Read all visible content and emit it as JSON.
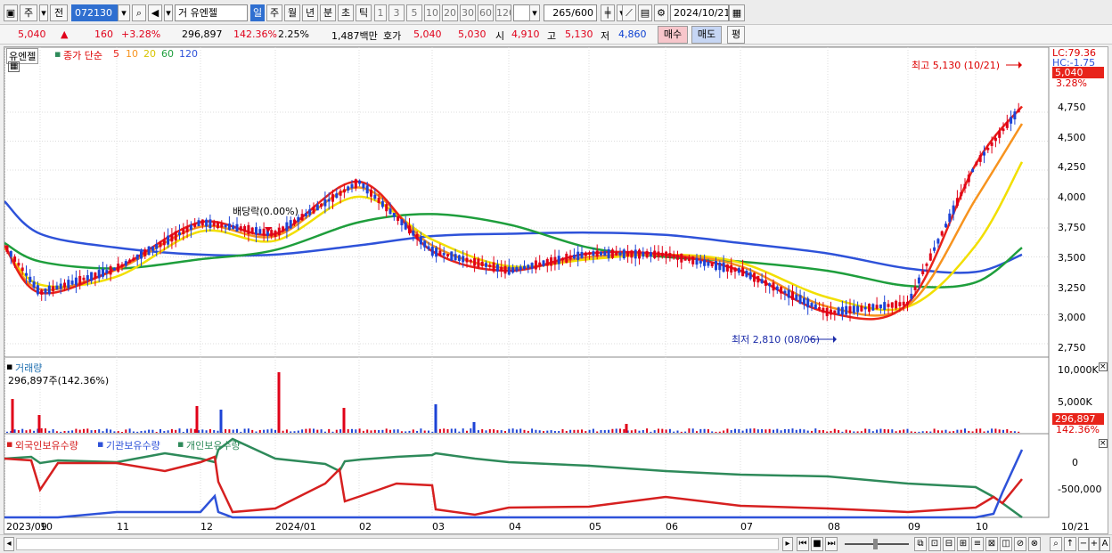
{
  "toolbar": {
    "market_type": "주",
    "prev_label": "전",
    "code": "072130",
    "name_prefix": "거",
    "name": "유엔젤",
    "period_tabs": [
      "일",
      "주",
      "월",
      "년",
      "분",
      "초",
      "틱"
    ],
    "selected_period": "일",
    "intervals": [
      "1",
      "3",
      "5",
      "10",
      "20",
      "30",
      "60",
      "120"
    ],
    "count": "265",
    "count_max": "/600",
    "date": "2024/10/21"
  },
  "price_row": {
    "price": "5,040",
    "change": "160",
    "change_pct": "+3.28%",
    "volume": "296,897",
    "volume_ratio": "142.36%",
    "turnover": "2.25%",
    "amount": "1,487백만",
    "quote_label": "호가",
    "ask": "5,040",
    "bid": "5,030",
    "open_label": "시",
    "open": "4,910",
    "high_label": "고",
    "high": "5,130",
    "low_label": "저",
    "low": "4,860",
    "buy_button": "매수",
    "sell_button": "매도",
    "eval_button": "평"
  },
  "price_panel": {
    "stock_label": "유엔젤",
    "ma_legend": "종가 단순",
    "ma_periods": [
      "5",
      "10",
      "20",
      "60",
      "120"
    ],
    "ma_colors": [
      "#e8231a",
      "#f7931e",
      "#f2df00",
      "#1e9e3c",
      "#2e52d9"
    ],
    "ex_dividend": "배당락(0.00%)",
    "max_label": "최고 5,130 (10/21)",
    "min_label": "최저 2,810 (08/06)",
    "lc": "LC:79.36",
    "hc": "HC:-1.75",
    "last_price": "5,040",
    "last_pct": "3.28%",
    "yticks": [
      "4,750",
      "4,500",
      "4,250",
      "4,000",
      "3,750",
      "3,500",
      "3,250",
      "3,000",
      "2,750"
    ]
  },
  "volume_panel": {
    "title": "거래량",
    "value_label": "296,897주(142.36%)",
    "yticks": [
      "10,000K",
      "5,000K"
    ],
    "last_value": "296,897",
    "last_pct": "142.36%"
  },
  "holding_panel": {
    "legend": [
      "외국인보유수량",
      "기관보유수량",
      "개인보유수량"
    ],
    "legend_colors": [
      "#d62020",
      "#2e52d9",
      "#2e8a5a"
    ],
    "yticks": [
      "0",
      "-500,000"
    ]
  },
  "x_axis": [
    "2023/09",
    "10",
    "11",
    "12",
    "2024/01",
    "02",
    "03",
    "04",
    "05",
    "06",
    "07",
    "08",
    "09",
    "10",
    "10/21"
  ],
  "chart_data": {
    "type": "line",
    "title": "유엔젤",
    "ylim": [
      2650,
      5250
    ],
    "high": {
      "label": "최고",
      "value": 5130,
      "date": "10/21"
    },
    "low": {
      "label": "최저",
      "value": 2810,
      "date": "08/06"
    },
    "dates": [
      "2023/09/10",
      "2023/10",
      "2023/11",
      "2023/12",
      "2024/01",
      "2024/02",
      "2024/03",
      "2024/04",
      "2024/05",
      "2024/06",
      "2024/07",
      "2024/08",
      "2024/09",
      "2024/10",
      "2024/10/21"
    ],
    "series": [
      {
        "name": "5",
        "values": [
          3600,
          3190,
          3400,
          3800,
          3700,
          4150,
          3550,
          3380,
          3530,
          3520,
          3380,
          3020,
          3100,
          4300,
          4800
        ]
      },
      {
        "name": "10",
        "values": [
          3590,
          3220,
          3390,
          3760,
          3680,
          4100,
          3600,
          3400,
          3500,
          3520,
          3420,
          3070,
          3080,
          4000,
          4650
        ]
      },
      {
        "name": "20",
        "values": [
          3580,
          3260,
          3330,
          3720,
          3640,
          4020,
          3650,
          3420,
          3480,
          3520,
          3450,
          3150,
          3070,
          3600,
          4320
        ]
      },
      {
        "name": "60",
        "values": [
          3620,
          3460,
          3400,
          3480,
          3560,
          3800,
          3870,
          3780,
          3580,
          3500,
          3460,
          3380,
          3250,
          3280,
          3580
        ]
      },
      {
        "name": "120",
        "values": [
          3980,
          3700,
          3580,
          3520,
          3520,
          3600,
          3680,
          3700,
          3710,
          3690,
          3620,
          3530,
          3400,
          3370,
          3520
        ]
      }
    ]
  }
}
